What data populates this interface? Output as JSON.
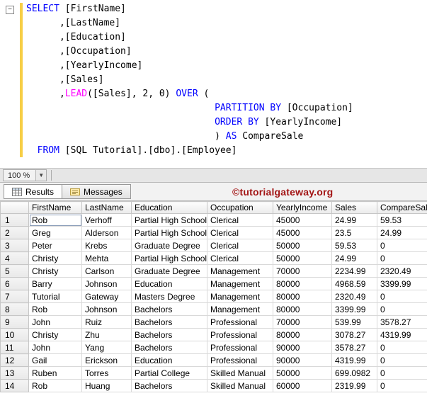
{
  "colors": {
    "keyword": "#0000ff",
    "function": "#ff00ff",
    "watermark": "#a31515",
    "change_bar": "#f7ce46",
    "text": "#000000"
  },
  "editor": {
    "lines": [
      [
        {
          "c": "k",
          "t": "SELECT"
        },
        {
          "c": "p",
          "t": " [FirstName]"
        }
      ],
      [
        {
          "c": "p",
          "t": "      ,[LastName]"
        }
      ],
      [
        {
          "c": "p",
          "t": "      ,[Education]"
        }
      ],
      [
        {
          "c": "p",
          "t": "      ,[Occupation]"
        }
      ],
      [
        {
          "c": "p",
          "t": "      ,[YearlyIncome]"
        }
      ],
      [
        {
          "c": "p",
          "t": "      ,[Sales]"
        }
      ],
      [
        {
          "c": "p",
          "t": "      ,"
        },
        {
          "c": "f",
          "t": "LEAD"
        },
        {
          "c": "p",
          "t": "([Sales], 2, 0) "
        },
        {
          "c": "k",
          "t": "OVER"
        },
        {
          "c": "p",
          "t": " ("
        }
      ],
      [
        {
          "c": "p",
          "t": "                                  "
        },
        {
          "c": "k",
          "t": "PARTITION BY"
        },
        {
          "c": "p",
          "t": " [Occupation]"
        }
      ],
      [
        {
          "c": "p",
          "t": "                                  "
        },
        {
          "c": "k",
          "t": "ORDER BY"
        },
        {
          "c": "p",
          "t": " [YearlyIncome]"
        }
      ],
      [
        {
          "c": "p",
          "t": "                                  ) "
        },
        {
          "c": "k",
          "t": "AS"
        },
        {
          "c": "p",
          "t": " CompareSale"
        }
      ],
      [
        {
          "c": "p",
          "t": "  "
        },
        {
          "c": "k",
          "t": "FROM"
        },
        {
          "c": "p",
          "t": " [SQL Tutorial].[dbo].[Employee]"
        }
      ]
    ]
  },
  "statusbar": {
    "zoom_value": "100 %"
  },
  "tabs": {
    "results": {
      "label": "Results",
      "icon": "results-grid-icon"
    },
    "messages": {
      "label": "Messages",
      "icon": "messages-note-icon"
    }
  },
  "watermark": "©tutorialgateway.org",
  "grid": {
    "columns": [
      "FirstName",
      "LastName",
      "Education",
      "Occupation",
      "YearlyIncome",
      "Sales",
      "CompareSale"
    ],
    "selected": {
      "row": 0,
      "col": 0
    },
    "rows": [
      [
        "Rob",
        "Verhoff",
        "Partial High School",
        "Clerical",
        "45000",
        "24.99",
        "59.53"
      ],
      [
        "Greg",
        "Alderson",
        "Partial High School",
        "Clerical",
        "45000",
        "23.5",
        "24.99"
      ],
      [
        "Peter",
        "Krebs",
        "Graduate Degree",
        "Clerical",
        "50000",
        "59.53",
        "0"
      ],
      [
        "Christy",
        "Mehta",
        "Partial High School",
        "Clerical",
        "50000",
        "24.99",
        "0"
      ],
      [
        "Christy",
        "Carlson",
        "Graduate Degree",
        "Management",
        "70000",
        "2234.99",
        "2320.49"
      ],
      [
        "Barry",
        "Johnson",
        "Education",
        "Management",
        "80000",
        "4968.59",
        "3399.99"
      ],
      [
        "Tutorial",
        "Gateway",
        "Masters Degree",
        "Management",
        "80000",
        "2320.49",
        "0"
      ],
      [
        "Rob",
        "Johnson",
        "Bachelors",
        "Management",
        "80000",
        "3399.99",
        "0"
      ],
      [
        "John",
        "Ruiz",
        "Bachelors",
        "Professional",
        "70000",
        "539.99",
        "3578.27"
      ],
      [
        "Christy",
        "Zhu",
        "Bachelors",
        "Professional",
        "80000",
        "3078.27",
        "4319.99"
      ],
      [
        "John",
        "Yang",
        "Bachelors",
        "Professional",
        "90000",
        "3578.27",
        "0"
      ],
      [
        "Gail",
        "Erickson",
        "Education",
        "Professional",
        "90000",
        "4319.99",
        "0"
      ],
      [
        "Ruben",
        "Torres",
        "Partial College",
        "Skilled Manual",
        "50000",
        "699.0982",
        "0"
      ],
      [
        "Rob",
        "Huang",
        "Bachelors",
        "Skilled Manual",
        "60000",
        "2319.99",
        "0"
      ]
    ]
  }
}
